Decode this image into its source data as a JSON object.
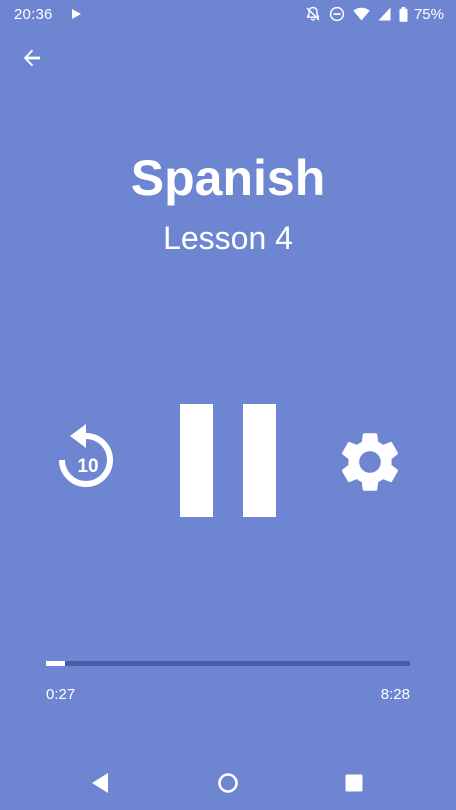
{
  "status_bar": {
    "time": "20:36",
    "battery_percent": "75%",
    "icons": [
      "play-icon",
      "notifications-off-icon",
      "do-not-disturb-icon",
      "wifi-icon",
      "signal-icon",
      "battery-icon"
    ]
  },
  "header": {
    "back_icon": "arrow-left-icon"
  },
  "lesson": {
    "title": "Spanish",
    "subtitle": "Lesson 4"
  },
  "controls": {
    "replay_icon": "replay-10-icon",
    "replay_label": "10",
    "pause_icon": "pause-icon",
    "settings_icon": "gear-icon"
  },
  "progress": {
    "elapsed": "0:27",
    "total": "8:28",
    "fraction": 0.053
  },
  "nav_bar": {
    "icons": [
      "nav-back-icon",
      "nav-home-icon",
      "nav-recents-icon"
    ]
  },
  "colors": {
    "background": "#6E86D2",
    "track": "#4A5BA8",
    "foreground": "#FFFFFF"
  }
}
